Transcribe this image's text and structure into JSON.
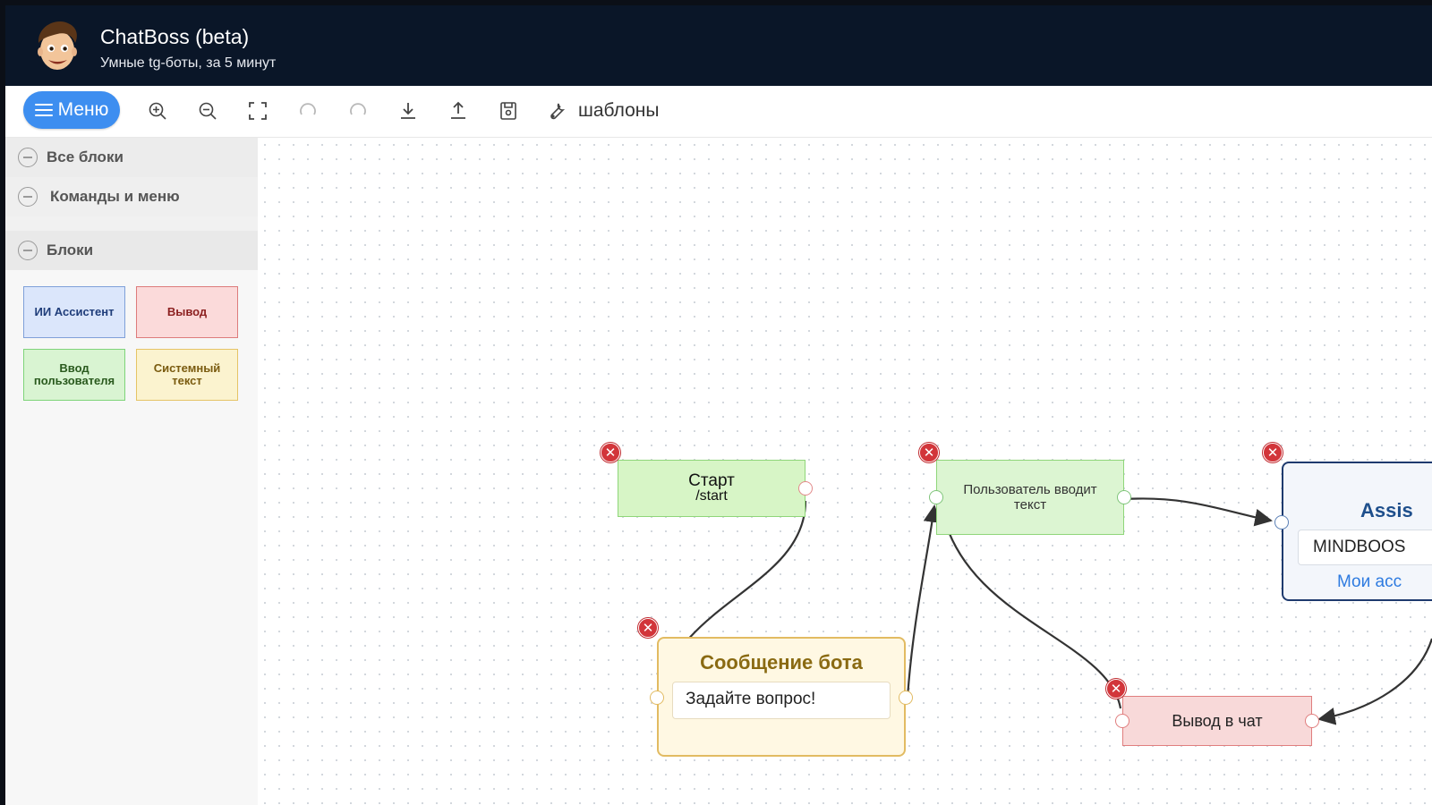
{
  "header": {
    "title": "ChatBoss (beta)",
    "subtitle": "Умные tg-боты, за 5 минут"
  },
  "toolbar": {
    "menu_label": "Меню",
    "tools": [
      "zoom-in-icon",
      "zoom-out-icon",
      "fit-screen-icon",
      "undo-icon",
      "redo-icon",
      "download-icon",
      "upload-icon",
      "save-icon",
      "wrench-icon"
    ],
    "templates_label": "шаблоны"
  },
  "sidebar": {
    "sections": [
      {
        "label": "Все блоки"
      },
      {
        "label": "Команды и меню"
      },
      {
        "label": "Блоки"
      }
    ],
    "palette": [
      {
        "label": "ИИ Ассистент",
        "color": "#1f3d7a",
        "bg": "#dbe6fb",
        "border": "#7fa0d9"
      },
      {
        "label": "Вывод",
        "color": "#8b1f1f",
        "bg": "#fbdada",
        "border": "#dd7b7b"
      },
      {
        "label": "Ввод пользователя",
        "color": "#2a5a1e",
        "bg": "#d9f4d2",
        "border": "#7fd47a"
      },
      {
        "label": "Системный текст",
        "color": "#7a5b0f",
        "bg": "#fbf3cf",
        "border": "#e5c466"
      }
    ]
  },
  "canvas": {
    "nodes": {
      "start": {
        "title": "Старт",
        "command": "/start",
        "bg": "#d7f5c6",
        "border": "#8fd67a"
      },
      "user_input": {
        "text": "Пользователь вводит текст",
        "bg": "#dcf5d2",
        "border": "#8fd67a"
      },
      "bot_message": {
        "title": "Сообщение бота",
        "field_value": "Задайте вопрос!",
        "bg": "#fff8e3",
        "border": "#e2bb62"
      },
      "assistant": {
        "title": "Assis",
        "field_value": "MINDBOOS",
        "link": "Мои асс",
        "bg": "#f3f6fb",
        "border": "#1e3a6e"
      },
      "output": {
        "text": "Вывод в чат",
        "bg": "#f8d9d9",
        "border": "#e07e7e"
      }
    },
    "delete_glyph": "✕"
  },
  "colors": {
    "header_bg": "#0a1628",
    "accent": "#3d8ef0",
    "delete_red": "#d2353a",
    "edge": "#333333"
  }
}
